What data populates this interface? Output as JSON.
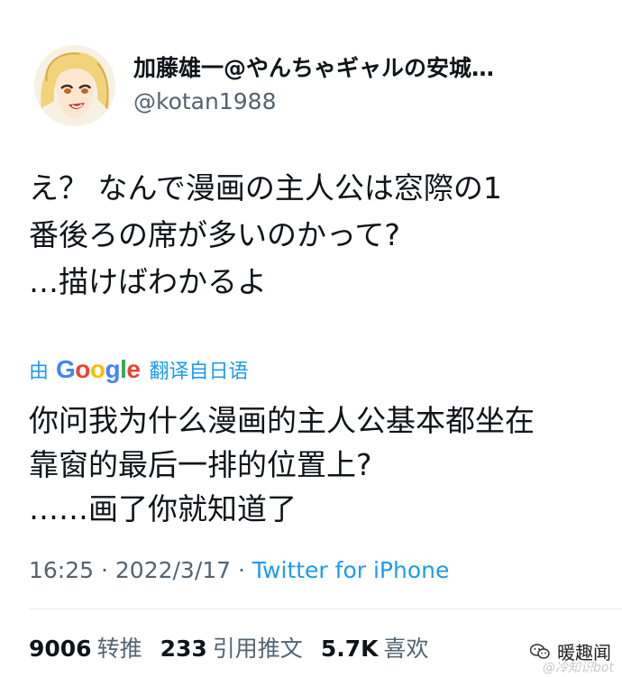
{
  "author": {
    "display_name": "加藤雄一@やんちゃギャルの安城…",
    "handle": "@kotan1988"
  },
  "tweet": {
    "lines": [
      "え？ なんで漫画の主人公は窓際の1",
      "番後ろの席が多いのかって?",
      "…描けばわかるよ"
    ]
  },
  "translation_bar": {
    "by": "由",
    "brand": "Google",
    "action": "翻译自日语"
  },
  "translated": {
    "lines": [
      "你问我为什么漫画的主人公基本都坐在",
      "靠窗的最后一排的位置上?",
      "……画了你就知道了"
    ]
  },
  "meta": {
    "time": "16:25",
    "sep1": " · ",
    "date": "2022/3/17",
    "sep2": " · ",
    "source": "Twitter for iPhone"
  },
  "stats": {
    "retweets_count": "9006",
    "retweets_label": "转推",
    "quotes_count": "233",
    "quotes_label": "引用推文",
    "likes_count": "5.7K",
    "likes_label": "喜欢"
  },
  "watermark": {
    "account": "暖趣闻",
    "sub": "@冷知识bot"
  },
  "colors": {
    "link_blue": "#1d9bf0",
    "secondary": "#536471",
    "google_blue": "#4285F4",
    "google_red": "#EA4335",
    "google_yellow": "#FBBC05",
    "google_green": "#34A853"
  }
}
